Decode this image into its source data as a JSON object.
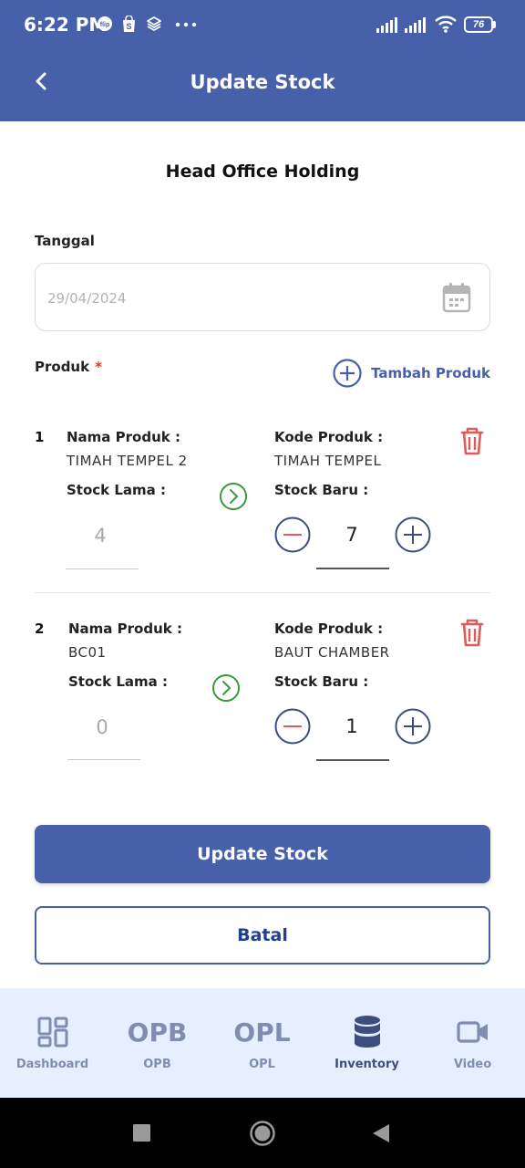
{
  "status_bar": {
    "time": "6:22 PM",
    "battery": "76"
  },
  "app_bar": {
    "title": "Update Stock"
  },
  "company": "Head Office Holding",
  "form": {
    "date_label": "Tanggal",
    "date_value": "29/04/2024",
    "product_label": "Produk",
    "required_mark": "*",
    "add_product_label": "Tambah Produk"
  },
  "items": [
    {
      "number": "1",
      "name_label": "Nama Produk :",
      "name": "TIMAH TEMPEL 2",
      "code_label": "Kode Produk :",
      "code": "TIMAH TEMPEL",
      "old_stock_label": "Stock Lama :",
      "old_stock": "4",
      "new_stock_label": "Stock Baru :",
      "new_stock": "7"
    },
    {
      "number": "2",
      "name_label": "Nama Produk :",
      "name": "BC01",
      "code_label": "Kode Produk :",
      "code": "BAUT CHAMBER",
      "old_stock_label": "Stock Lama :",
      "old_stock": "0",
      "new_stock_label": "Stock Baru :",
      "new_stock": "1"
    }
  ],
  "buttons": {
    "update": "Update Stock",
    "cancel": "Batal"
  },
  "nav": [
    {
      "label": "Dashboard",
      "icon": "grid-icon",
      "active": false
    },
    {
      "label": "OPB",
      "icon_text": "OPB",
      "active": false
    },
    {
      "label": "OPL",
      "icon_text": "OPL",
      "active": false
    },
    {
      "label": "Inventory",
      "icon": "database-icon",
      "active": true
    },
    {
      "label": "Video",
      "icon": "video-icon",
      "active": false
    }
  ],
  "colors": {
    "primary": "#4660aa",
    "danger": "#e05a5a",
    "success": "#3a9a3a",
    "nav_bg": "#e6efff"
  }
}
